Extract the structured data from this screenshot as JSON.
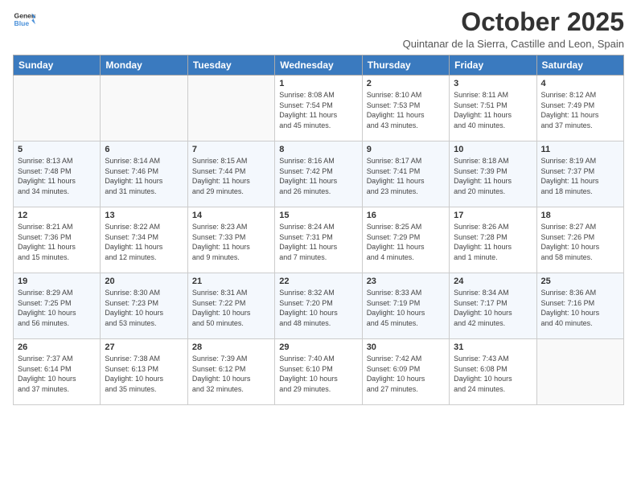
{
  "header": {
    "logo_line1": "General",
    "logo_line2": "Blue",
    "month": "October 2025",
    "location": "Quintanar de la Sierra, Castille and Leon, Spain"
  },
  "weekdays": [
    "Sunday",
    "Monday",
    "Tuesday",
    "Wednesday",
    "Thursday",
    "Friday",
    "Saturday"
  ],
  "weeks": [
    [
      {
        "day": "",
        "info": ""
      },
      {
        "day": "",
        "info": ""
      },
      {
        "day": "",
        "info": ""
      },
      {
        "day": "1",
        "info": "Sunrise: 8:08 AM\nSunset: 7:54 PM\nDaylight: 11 hours\nand 45 minutes."
      },
      {
        "day": "2",
        "info": "Sunrise: 8:10 AM\nSunset: 7:53 PM\nDaylight: 11 hours\nand 43 minutes."
      },
      {
        "day": "3",
        "info": "Sunrise: 8:11 AM\nSunset: 7:51 PM\nDaylight: 11 hours\nand 40 minutes."
      },
      {
        "day": "4",
        "info": "Sunrise: 8:12 AM\nSunset: 7:49 PM\nDaylight: 11 hours\nand 37 minutes."
      }
    ],
    [
      {
        "day": "5",
        "info": "Sunrise: 8:13 AM\nSunset: 7:48 PM\nDaylight: 11 hours\nand 34 minutes."
      },
      {
        "day": "6",
        "info": "Sunrise: 8:14 AM\nSunset: 7:46 PM\nDaylight: 11 hours\nand 31 minutes."
      },
      {
        "day": "7",
        "info": "Sunrise: 8:15 AM\nSunset: 7:44 PM\nDaylight: 11 hours\nand 29 minutes."
      },
      {
        "day": "8",
        "info": "Sunrise: 8:16 AM\nSunset: 7:42 PM\nDaylight: 11 hours\nand 26 minutes."
      },
      {
        "day": "9",
        "info": "Sunrise: 8:17 AM\nSunset: 7:41 PM\nDaylight: 11 hours\nand 23 minutes."
      },
      {
        "day": "10",
        "info": "Sunrise: 8:18 AM\nSunset: 7:39 PM\nDaylight: 11 hours\nand 20 minutes."
      },
      {
        "day": "11",
        "info": "Sunrise: 8:19 AM\nSunset: 7:37 PM\nDaylight: 11 hours\nand 18 minutes."
      }
    ],
    [
      {
        "day": "12",
        "info": "Sunrise: 8:21 AM\nSunset: 7:36 PM\nDaylight: 11 hours\nand 15 minutes."
      },
      {
        "day": "13",
        "info": "Sunrise: 8:22 AM\nSunset: 7:34 PM\nDaylight: 11 hours\nand 12 minutes."
      },
      {
        "day": "14",
        "info": "Sunrise: 8:23 AM\nSunset: 7:33 PM\nDaylight: 11 hours\nand 9 minutes."
      },
      {
        "day": "15",
        "info": "Sunrise: 8:24 AM\nSunset: 7:31 PM\nDaylight: 11 hours\nand 7 minutes."
      },
      {
        "day": "16",
        "info": "Sunrise: 8:25 AM\nSunset: 7:29 PM\nDaylight: 11 hours\nand 4 minutes."
      },
      {
        "day": "17",
        "info": "Sunrise: 8:26 AM\nSunset: 7:28 PM\nDaylight: 11 hours\nand 1 minute."
      },
      {
        "day": "18",
        "info": "Sunrise: 8:27 AM\nSunset: 7:26 PM\nDaylight: 10 hours\nand 58 minutes."
      }
    ],
    [
      {
        "day": "19",
        "info": "Sunrise: 8:29 AM\nSunset: 7:25 PM\nDaylight: 10 hours\nand 56 minutes."
      },
      {
        "day": "20",
        "info": "Sunrise: 8:30 AM\nSunset: 7:23 PM\nDaylight: 10 hours\nand 53 minutes."
      },
      {
        "day": "21",
        "info": "Sunrise: 8:31 AM\nSunset: 7:22 PM\nDaylight: 10 hours\nand 50 minutes."
      },
      {
        "day": "22",
        "info": "Sunrise: 8:32 AM\nSunset: 7:20 PM\nDaylight: 10 hours\nand 48 minutes."
      },
      {
        "day": "23",
        "info": "Sunrise: 8:33 AM\nSunset: 7:19 PM\nDaylight: 10 hours\nand 45 minutes."
      },
      {
        "day": "24",
        "info": "Sunrise: 8:34 AM\nSunset: 7:17 PM\nDaylight: 10 hours\nand 42 minutes."
      },
      {
        "day": "25",
        "info": "Sunrise: 8:36 AM\nSunset: 7:16 PM\nDaylight: 10 hours\nand 40 minutes."
      }
    ],
    [
      {
        "day": "26",
        "info": "Sunrise: 7:37 AM\nSunset: 6:14 PM\nDaylight: 10 hours\nand 37 minutes."
      },
      {
        "day": "27",
        "info": "Sunrise: 7:38 AM\nSunset: 6:13 PM\nDaylight: 10 hours\nand 35 minutes."
      },
      {
        "day": "28",
        "info": "Sunrise: 7:39 AM\nSunset: 6:12 PM\nDaylight: 10 hours\nand 32 minutes."
      },
      {
        "day": "29",
        "info": "Sunrise: 7:40 AM\nSunset: 6:10 PM\nDaylight: 10 hours\nand 29 minutes."
      },
      {
        "day": "30",
        "info": "Sunrise: 7:42 AM\nSunset: 6:09 PM\nDaylight: 10 hours\nand 27 minutes."
      },
      {
        "day": "31",
        "info": "Sunrise: 7:43 AM\nSunset: 6:08 PM\nDaylight: 10 hours\nand 24 minutes."
      },
      {
        "day": "",
        "info": ""
      }
    ]
  ]
}
